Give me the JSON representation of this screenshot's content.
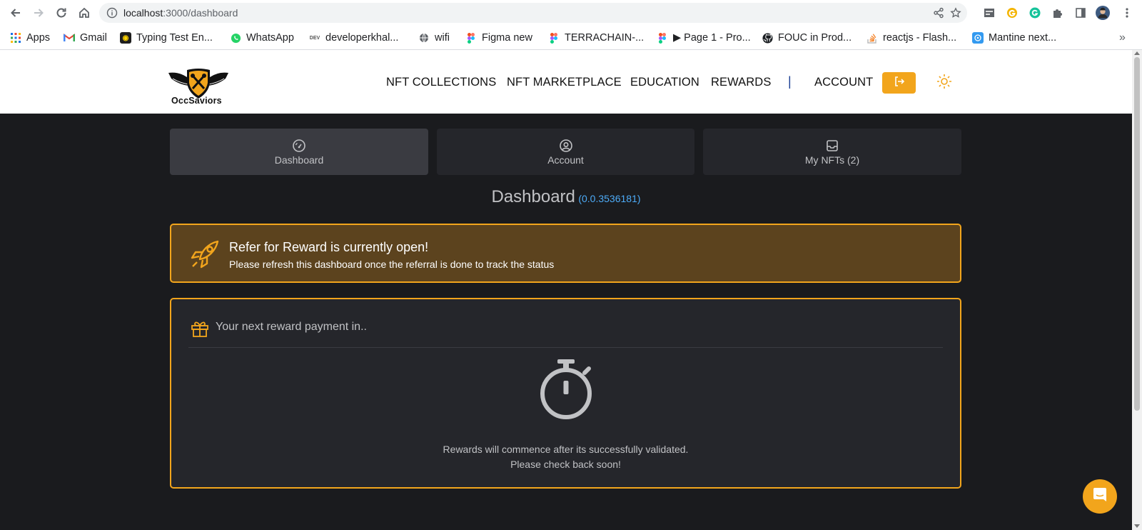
{
  "browser": {
    "url_host": "localhost",
    "url_path": ":3000/dashboard",
    "bookmarks": [
      {
        "label": "Apps",
        "icon": "apps-grid-icon"
      },
      {
        "label": "Gmail",
        "icon": "gmail-icon"
      },
      {
        "label": "Typing Test En...",
        "icon": "typing-test-icon"
      },
      {
        "label": "WhatsApp",
        "icon": "whatsapp-icon"
      },
      {
        "label": "developerkhal...",
        "icon": "dev-icon"
      },
      {
        "label": "wifi",
        "icon": "globe-icon"
      },
      {
        "label": "Figma new",
        "icon": "figma-icon"
      },
      {
        "label": "TERRACHAIN-...",
        "icon": "figma-icon"
      },
      {
        "label": "▶ Page 1 - Pro...",
        "icon": "figma-icon"
      },
      {
        "label": "FOUC in Prod...",
        "icon": "github-icon"
      },
      {
        "label": "reactjs - Flash...",
        "icon": "stackoverflow-icon"
      },
      {
        "label": "Mantine next...",
        "icon": "mantine-icon"
      }
    ],
    "overflow": "»"
  },
  "header": {
    "logo_text": "OccSaviors",
    "nav": [
      "NFT COLLECTIONS",
      "NFT MARKETPLACE",
      "EDUCATION",
      "REWARDS"
    ],
    "separator": "|",
    "account": "ACCOUNT"
  },
  "tabs": [
    {
      "label": "Dashboard",
      "icon": "gauge-icon"
    },
    {
      "label": "Account",
      "icon": "user-circle-icon"
    },
    {
      "label": "My NFTs (2)",
      "icon": "inbox-icon"
    }
  ],
  "dashboard": {
    "title": "Dashboard",
    "account_id": "(0.0.3536181)"
  },
  "alert": {
    "title": "Refer for Reward is currently open!",
    "text": "Please refresh this dashboard once the referral is done to track the status"
  },
  "reward": {
    "title": "Your next reward payment in..",
    "line1": "Rewards will commence after its successfully validated.",
    "line2": "Please check back soon!"
  },
  "colors": {
    "accent": "#f2a51c",
    "background": "#1a1b1e",
    "card": "#25262b",
    "alert_bg": "#5c431e",
    "link": "#4dabf7"
  }
}
